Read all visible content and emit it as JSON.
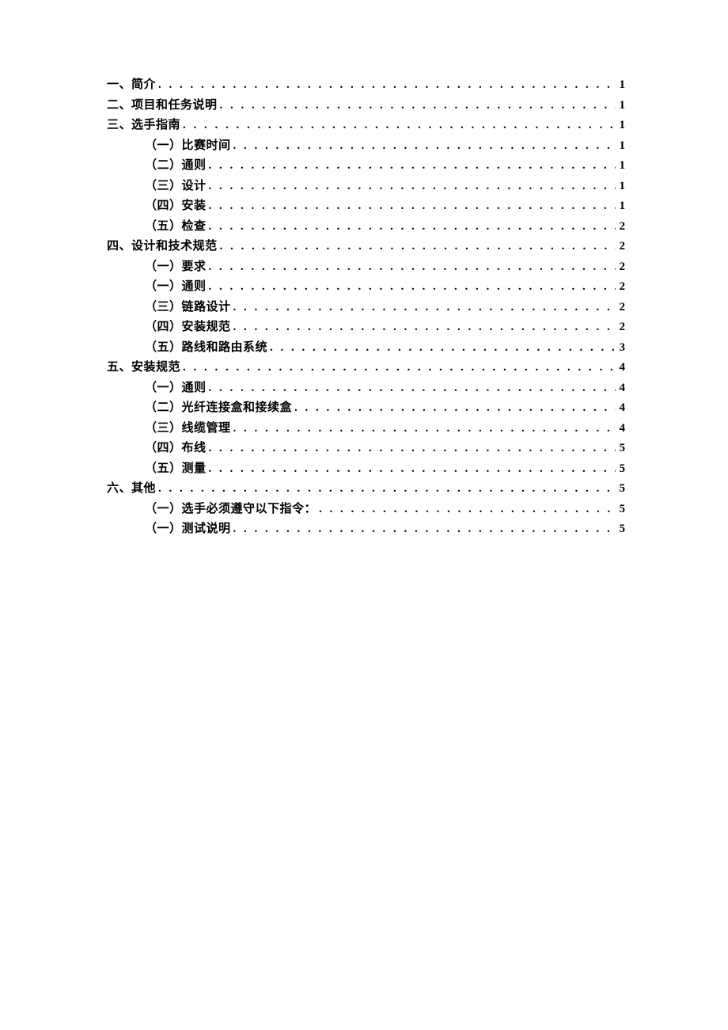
{
  "toc": [
    {
      "level": 1,
      "label": "一、简介",
      "page": "1"
    },
    {
      "level": 1,
      "label": "二、项目和任务说明",
      "page": "1"
    },
    {
      "level": 1,
      "label": "三、选手指南",
      "page": "1"
    },
    {
      "level": 2,
      "label": "（一）比赛时间",
      "page": "1"
    },
    {
      "level": 2,
      "label": "（二）通则",
      "page": "1"
    },
    {
      "level": 2,
      "label": "（三）设计",
      "page": "1"
    },
    {
      "level": 2,
      "label": "（四）安装",
      "page": "1"
    },
    {
      "level": 2,
      "label": "（五）检查",
      "page": "2"
    },
    {
      "level": 1,
      "label": "四、设计和技术规范",
      "page": "2"
    },
    {
      "level": 2,
      "label": "（一）要求",
      "page": "2"
    },
    {
      "level": 2,
      "label": "（一）通则",
      "page": "2"
    },
    {
      "level": 2,
      "label": "（三）链路设计",
      "page": "2"
    },
    {
      "level": 2,
      "label": "（四）安装规范",
      "page": "2"
    },
    {
      "level": 2,
      "label": "（五）路线和路由系统",
      "page": "3"
    },
    {
      "level": 1,
      "label": "五、安装规范",
      "page": "4"
    },
    {
      "level": 2,
      "label": "（一）通则",
      "page": "4"
    },
    {
      "level": 2,
      "label": "（二）光纤连接盒和接续盒",
      "page": "4"
    },
    {
      "level": 2,
      "label": "（三）线缆管理",
      "page": "4"
    },
    {
      "level": 2,
      "label": "（四）布线",
      "page": "5"
    },
    {
      "level": 2,
      "label": "（五）测量",
      "page": "5"
    },
    {
      "level": 1,
      "label": "六、其他",
      "page": "5"
    },
    {
      "level": 2,
      "label": "（一）选手必须遵守以下指令：",
      "page": "5"
    },
    {
      "level": 2,
      "label": "（一）测试说明",
      "page": "5"
    }
  ]
}
